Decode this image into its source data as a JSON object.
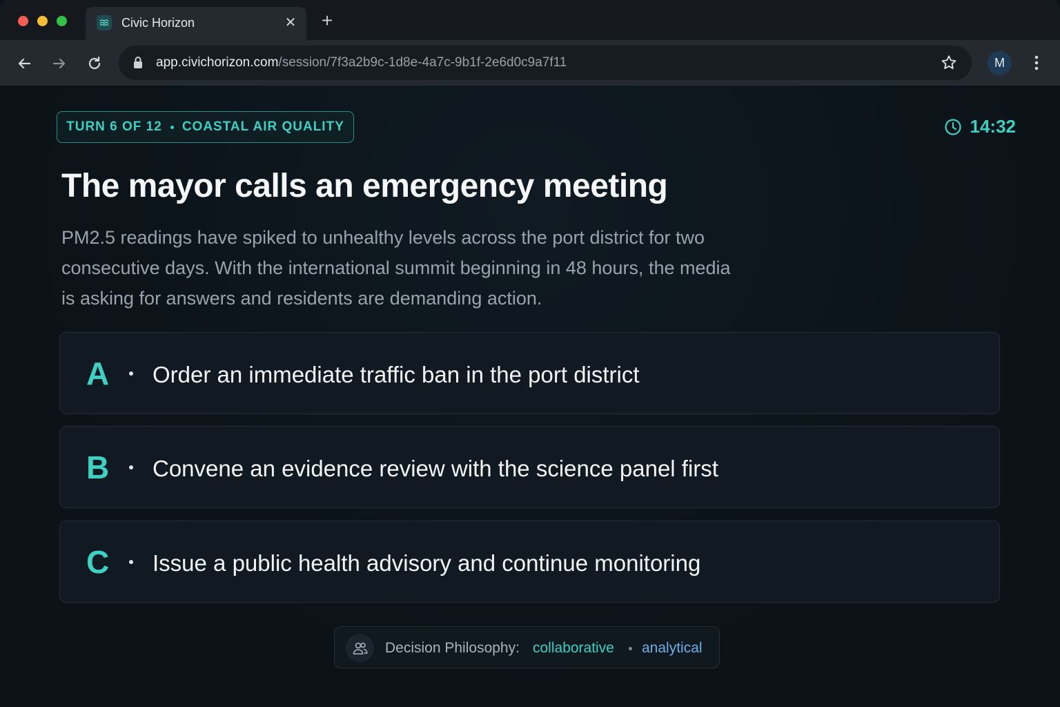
{
  "browser": {
    "tab_title": "Civic Horizon",
    "url_host": "app.civichorizon.com",
    "url_path": "/session/7f3a2b9c-1d8e-4a7c-9b1f-2e6d0c9a7f11",
    "profile_initial": "M"
  },
  "header": {
    "turn": "TURN 6 OF 12",
    "scenario": "COASTAL AIR QUALITY",
    "timer": "14:32"
  },
  "scenario": {
    "title": "The mayor calls an emergency meeting",
    "description": "PM2.5 readings have spiked to unhealthy levels across the port district for two consecutive days. With the international summit beginning in 48 hours, the media is asking for answers and residents are demanding action."
  },
  "options": [
    {
      "letter": "A",
      "text": "Order an immediate traffic ban in the port district"
    },
    {
      "letter": "B",
      "text": "Convene an evidence review with the science panel first"
    },
    {
      "letter": "C",
      "text": "Issue a public health advisory and continue monitoring"
    }
  ],
  "philosophy": {
    "label": "Decision Philosophy:",
    "values": [
      "collaborative",
      "analytical"
    ]
  },
  "colors": {
    "accent": "#3fd0c1",
    "secondary_accent": "#6fb0e8",
    "background": "#0c141b"
  },
  "icons": [
    "civic-horizon-logo-icon",
    "close-icon",
    "plus-icon",
    "back-arrow-icon",
    "forward-arrow-icon",
    "reload-icon",
    "lock-icon",
    "star-icon",
    "kebab-menu-icon",
    "clock-icon",
    "people-icon"
  ]
}
